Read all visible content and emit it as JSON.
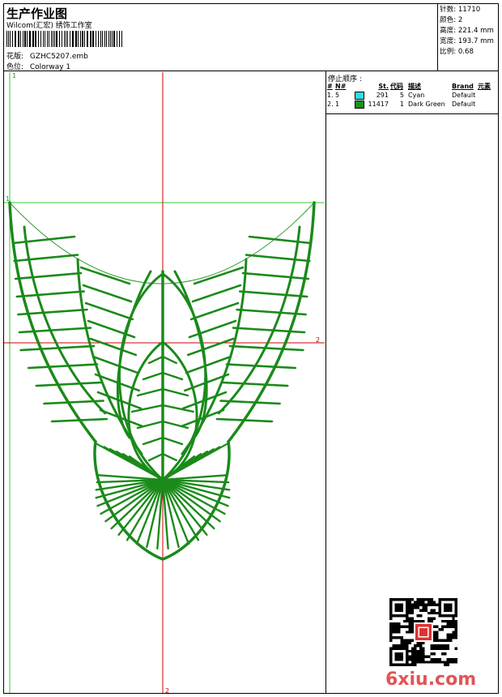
{
  "header": {
    "title": "生产作业图",
    "subtitle": "Wilcom(汇宏) 绣饰工作室",
    "design_label": "花版:",
    "design_value": "GZHC5207.emb",
    "colorway_label": "色位:",
    "colorway_value": "Colorway 1"
  },
  "stats": [
    {
      "label": "针数:",
      "value": "11710"
    },
    {
      "label": "颜色:",
      "value": "2"
    },
    {
      "label": "高度:",
      "value": "221.4 mm"
    },
    {
      "label": "宽度:",
      "value": "193.7 mm"
    },
    {
      "label": "比例:",
      "value": "0.68"
    }
  ],
  "color_sequence": {
    "title": "停止顺序 :",
    "headers": [
      "#",
      "N#",
      "",
      "St.",
      "代码",
      "描述",
      "Brand",
      "元素"
    ],
    "rows": [
      {
        "idx": "1.",
        "n": "5",
        "color": "#33dddd",
        "st": "291",
        "code": "5",
        "desc": "Cyan",
        "brand": "Default"
      },
      {
        "idx": "2.",
        "n": "1",
        "color": "#169416",
        "st": "11417",
        "code": "1",
        "desc": "Dark Green",
        "brand": "Default"
      }
    ]
  },
  "guides": {
    "vertical_label_top": "1",
    "horizontal_label_left": "1",
    "h_center_label": "2",
    "v_center_label": "2"
  },
  "watermark": "6xiu.com",
  "colors": {
    "stitch": "#1a8a1a",
    "outline": "#2d9a2d",
    "guide_green": "#33cc33",
    "guide_red": "#cc0000"
  }
}
